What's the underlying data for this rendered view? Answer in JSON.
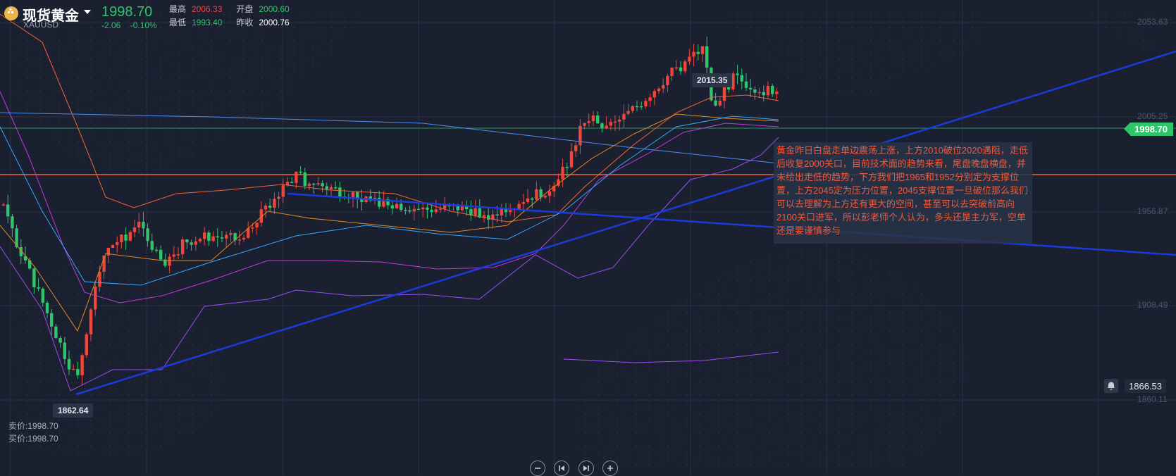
{
  "header": {
    "title": "现货黄金",
    "symbol": "XAUUSD",
    "price": "1998.70",
    "change": "-2.06",
    "change_pct": "-0.10%",
    "stats": {
      "high_label": "最高",
      "high": "2006.33",
      "open_label": "开盘",
      "open": "2000.60",
      "low_label": "最低",
      "low": "1993.40",
      "prev_label": "昨收",
      "prev": "2000.76"
    }
  },
  "axis_labels": [
    "2053.63",
    "2005.25",
    "1956.87",
    "1908.49",
    "1860.11"
  ],
  "current_price_tag": "1998.70",
  "alert_value": "1866.53",
  "high_marker": "2015.35",
  "low_marker": "1862.64",
  "bid": "卖价:1998.70",
  "ask": "买价:1998.70",
  "annotation": "黄金昨日白盘走单边震荡上涨，上方2010破位2020遇阻，走低后收复2000关口，目前技术面的趋势来看，尾盘晚盘横盘，并未给出走低的趋势，下方我们把1965和1952分别定为支撑位置，上方2045定为压力位置，2045支撑位置一旦破位那么我们可以去理解为上方还有更大的空间，甚至可以去突破前高向2100关口进军，所以彭老师个人认为，多头还是主力军，空单还是要谨慎参与",
  "controls": [
    "zoom-out",
    "prev",
    "next",
    "zoom-in"
  ],
  "colors": {
    "background": "#1b2030",
    "up": "#f0453b",
    "down": "#2ec56b",
    "trendline": "#1b3bdc",
    "support_line": "#f0643a"
  }
}
